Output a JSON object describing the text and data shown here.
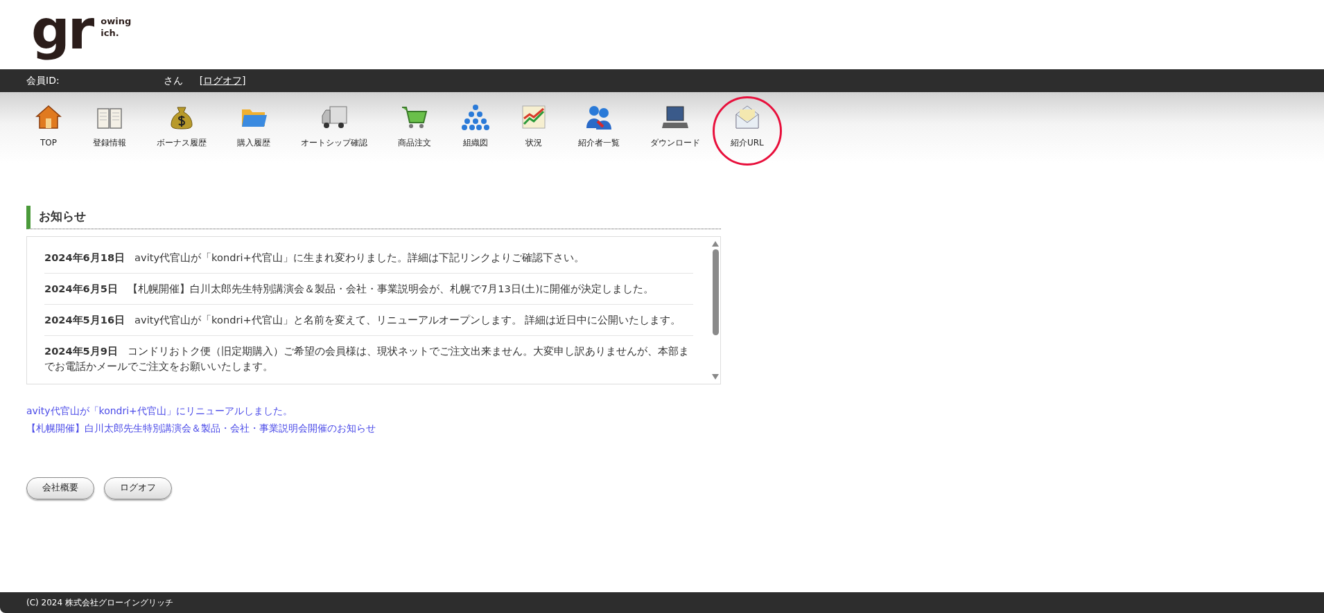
{
  "logo": {
    "mark_1": "g",
    "mark_2": "r",
    "line_1": "owing",
    "line_2": "ich."
  },
  "member_bar": {
    "id_label": "会員ID:",
    "honorific": "さん",
    "logoff_link": "[ログオフ]"
  },
  "nav": [
    {
      "label": "TOP",
      "kind": "house",
      "circled": false
    },
    {
      "label": "登録情報",
      "kind": "book",
      "circled": false
    },
    {
      "label": "ボーナス履歴",
      "kind": "moneybag",
      "circled": false
    },
    {
      "label": "購入履歴",
      "kind": "folder",
      "circled": false
    },
    {
      "label": "オートシップ確認",
      "kind": "truck",
      "circled": false
    },
    {
      "label": "商品注文",
      "kind": "cart",
      "circled": false
    },
    {
      "label": "組織図",
      "kind": "pyramid",
      "circled": false
    },
    {
      "label": "状況",
      "kind": "chart",
      "circled": false
    },
    {
      "label": "紹介者一覧",
      "kind": "people",
      "circled": false
    },
    {
      "label": "ダウンロード",
      "kind": "laptop",
      "circled": false
    },
    {
      "label": "紹介URL",
      "kind": "envelope",
      "circled": true
    }
  ],
  "notices": {
    "title": "お知らせ",
    "items": [
      {
        "date": "2024年6月18日",
        "text": "avity代官山が「kondri+代官山」に生まれ変わりました。詳細は下記リンクよりご確認下さい。"
      },
      {
        "date": "2024年6月5日",
        "text": "【札幌開催】白川太郎先生特別講演会＆製品・会社・事業説明会が、札幌で7月13日(土)に開催が決定しました。"
      },
      {
        "date": "2024年5月16日",
        "text": "avity代官山が「kondri+代官山」と名前を変えて、リニューアルオープンします。 詳細は近日中に公開いたします。"
      },
      {
        "date": "2024年5月9日",
        "text": "コンドリおトク便（旧定期購入）ご希望の会員様は、現状ネットでご注文出来ません。大変申し訳ありませんが、本部までお電話かメールでご注文をお願いいたします。"
      }
    ]
  },
  "links": [
    "avity代官山が「kondri+代官山」にリニューアルしました。",
    "【札幌開催】白川太郎先生特別講演会＆製品・会社・事業説明会開催のお知らせ"
  ],
  "buttons": [
    "会社概要",
    "ログオフ"
  ],
  "footer": "(C) 2024 株式会社グローイングリッチ"
}
